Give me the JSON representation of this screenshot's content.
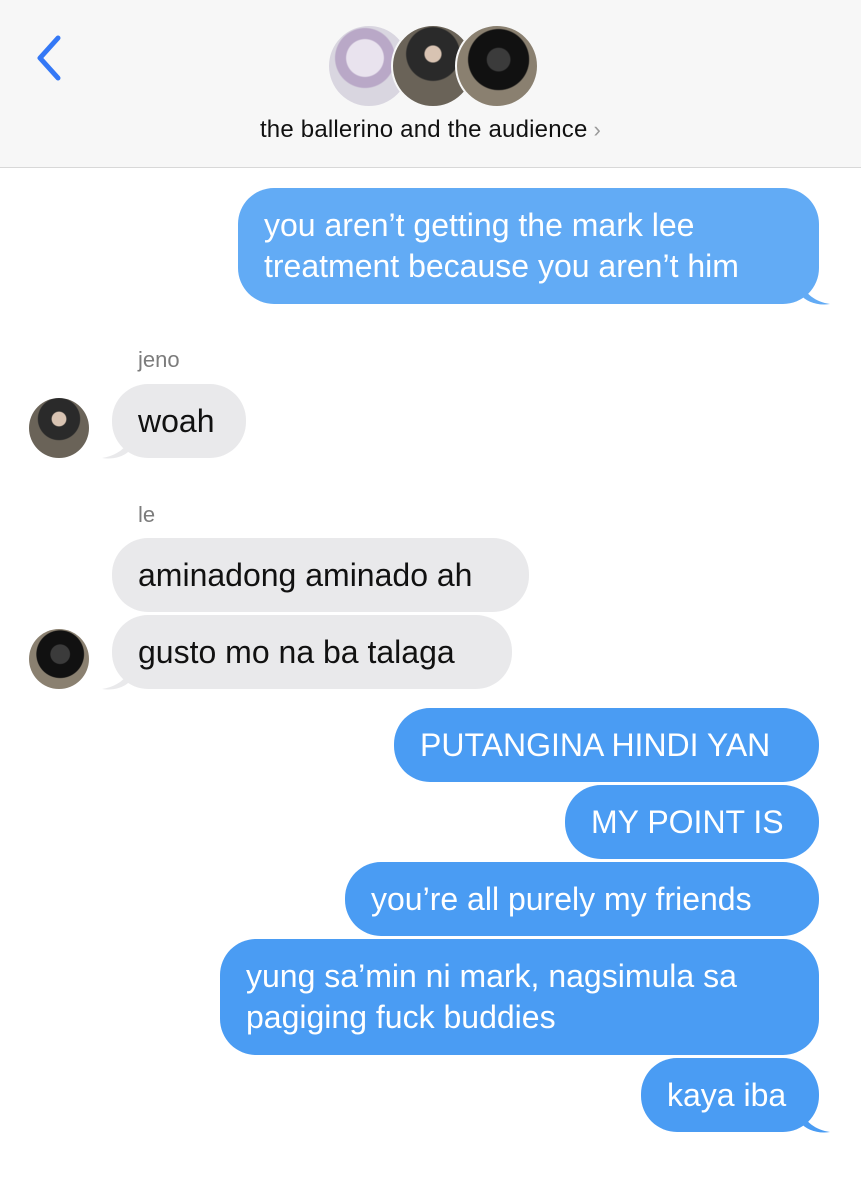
{
  "header": {
    "title": "the ballerino and the audience",
    "avatars": [
      "group-member-avatar-1",
      "group-member-avatar-2",
      "group-member-avatar-3"
    ]
  },
  "messages": {
    "m1": "you aren’t getting the mark lee treatment because you aren’t him",
    "jeno_name": "jeno",
    "m2": "woah",
    "le_name": "le",
    "m3": "aminadong aminado ah",
    "m4": "gusto mo na ba talaga",
    "m5": "PUTANGINA HINDI YAN",
    "m6": "MY POINT IS",
    "m7": "you’re all purely my friends",
    "m8": "yung sa’min ni mark, nagsimula sa pagiging fuck buddies",
    "m9": "kaya iba"
  },
  "colors": {
    "outgoing": "#4a9cf3",
    "outgoing_light": "#62abf5",
    "incoming": "#e9e9eb",
    "back_chevron": "#3478f6",
    "header_bg": "#f7f7f7"
  },
  "icons": {
    "back": "chevron-left-icon",
    "detail": "chevron-right-icon"
  }
}
